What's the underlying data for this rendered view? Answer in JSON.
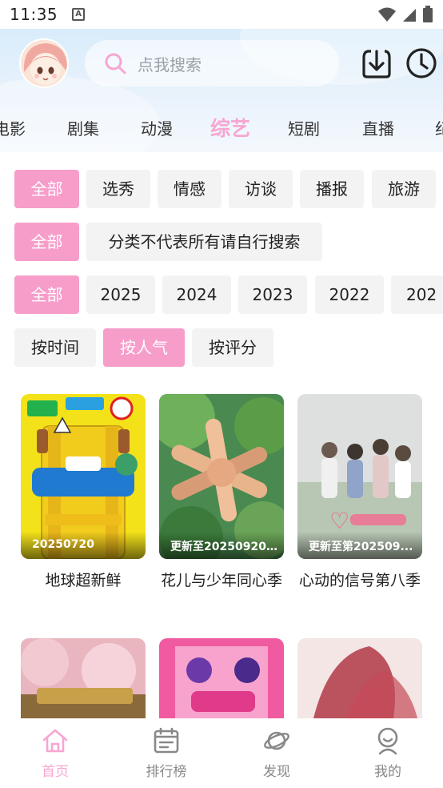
{
  "status_bar": {
    "time": "11:35",
    "notification_letter": "A"
  },
  "header": {
    "search_placeholder": "点我搜索",
    "tabs": [
      {
        "label": "电影"
      },
      {
        "label": "剧集"
      },
      {
        "label": "动漫"
      },
      {
        "label": "综艺",
        "active": true
      },
      {
        "label": "短剧"
      },
      {
        "label": "直播"
      },
      {
        "label": "纪"
      }
    ]
  },
  "filters": {
    "genre": [
      "全部",
      "选秀",
      "情感",
      "访谈",
      "播报",
      "旅游"
    ],
    "notice": [
      "全部",
      "分类不代表所有请自行搜索"
    ],
    "years": [
      "全部",
      "2025",
      "2024",
      "2023",
      "2022",
      "202"
    ],
    "sort": [
      "按时间",
      "按人气",
      "按评分"
    ],
    "active_genre": "全部",
    "active_year": "全部",
    "active_sort": "按人气"
  },
  "cards": [
    {
      "title": "地球超新鲜",
      "badge": "20250720"
    },
    {
      "title": "花儿与少年同心季",
      "badge": "更新至20250920..."
    },
    {
      "title": "心动的信号第八季",
      "badge": "更新至第202509..."
    }
  ],
  "bottom_nav": [
    {
      "label": "首页",
      "icon": "home-icon",
      "active": true
    },
    {
      "label": "排行榜",
      "icon": "calendar-icon"
    },
    {
      "label": "发现",
      "icon": "planet-icon"
    },
    {
      "label": "我的",
      "icon": "person-icon"
    }
  ],
  "colors": {
    "accent_pink": "#f79dca",
    "header_blue": "#d8ecfb",
    "chip_gray": "#f3f3f3"
  }
}
